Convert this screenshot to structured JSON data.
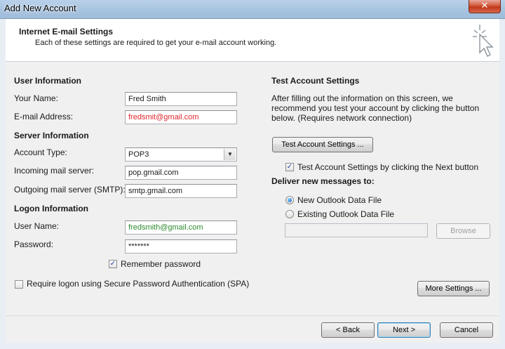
{
  "window": {
    "title": "Add New Account",
    "close_label": "✕"
  },
  "header": {
    "title": "Internet E-mail Settings",
    "subtitle": "Each of these settings are required to get your e-mail account working."
  },
  "user_info": {
    "heading": "User Information",
    "name_label": "Your Name:",
    "name_value": "Fred Smith",
    "email_label": "E-mail Address:",
    "email_value": "fredsmit@gmail.com"
  },
  "server_info": {
    "heading": "Server Information",
    "account_type_label": "Account Type:",
    "account_type_value": "POP3",
    "incoming_label": "Incoming mail server:",
    "incoming_value": "pop.gmail.com",
    "outgoing_label": "Outgoing mail server (SMTP):",
    "outgoing_value": "smtp.gmail.com"
  },
  "logon_info": {
    "heading": "Logon Information",
    "username_label": "User Name:",
    "username_value": "fredsmith@gmail.com",
    "password_label": "Password:",
    "password_value": "*******",
    "remember_label": "Remember password",
    "remember_checked": true,
    "spa_label": "Require logon using Secure Password Authentication (SPA)",
    "spa_checked": false
  },
  "test_settings": {
    "heading": "Test Account Settings",
    "description_1": "After filling out the information on this screen, we",
    "description_2": "recommend you test your account by clicking the button",
    "description_3": "below. (Requires network connection)",
    "test_button": "Test Account Settings ...",
    "test_next_label": "Test Account Settings by clicking the Next button",
    "test_next_checked": true
  },
  "deliver": {
    "heading": "Deliver new messages to:",
    "new_file_label": "New Outlook Data File",
    "existing_file_label": "Existing Outlook Data File",
    "selected": "new",
    "file_path_value": "",
    "browse_label": "Browse"
  },
  "buttons": {
    "more_settings": "More Settings ...",
    "back": "< Back",
    "next": "Next >",
    "cancel": "Cancel"
  }
}
